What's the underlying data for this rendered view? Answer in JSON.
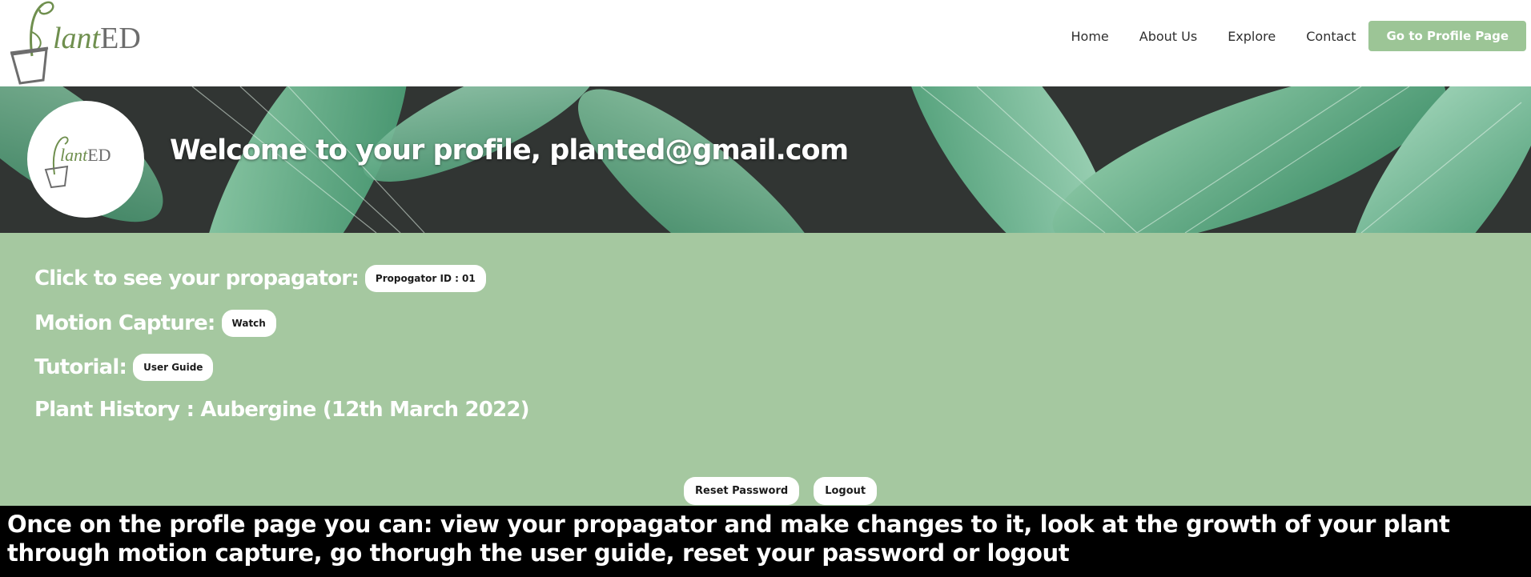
{
  "brand": {
    "logo_text_p": "P",
    "logo_text_lant": "lant",
    "logo_text_ed": "ED"
  },
  "nav": {
    "items": [
      {
        "label": "Home"
      },
      {
        "label": "About Us"
      },
      {
        "label": "Explore"
      },
      {
        "label": "Contact"
      }
    ],
    "profile_button": "Go to Profile Page"
  },
  "banner": {
    "welcome": "Welcome to your profile, planted@gmail.com"
  },
  "profile": {
    "rows": [
      {
        "label": "Click to see your propagator:",
        "button": "Propogator ID : 01"
      },
      {
        "label": "Motion Capture:",
        "button": "Watch"
      },
      {
        "label": "Tutorial:",
        "button": "User Guide"
      },
      {
        "label": "Plant History : Aubergine (12th March 2022)"
      }
    ],
    "reset_password": "Reset Password",
    "logout": "Logout"
  },
  "caption": {
    "text": "Once on the profle page you can: view your propagator and make changes to it, look at the growth of your plant through motion capture, go thorugh the user guide, reset your password or logout"
  },
  "colors": {
    "accent_green": "#9cc596",
    "panel_green": "#a5c8a0",
    "caption_bg": "#000000"
  }
}
